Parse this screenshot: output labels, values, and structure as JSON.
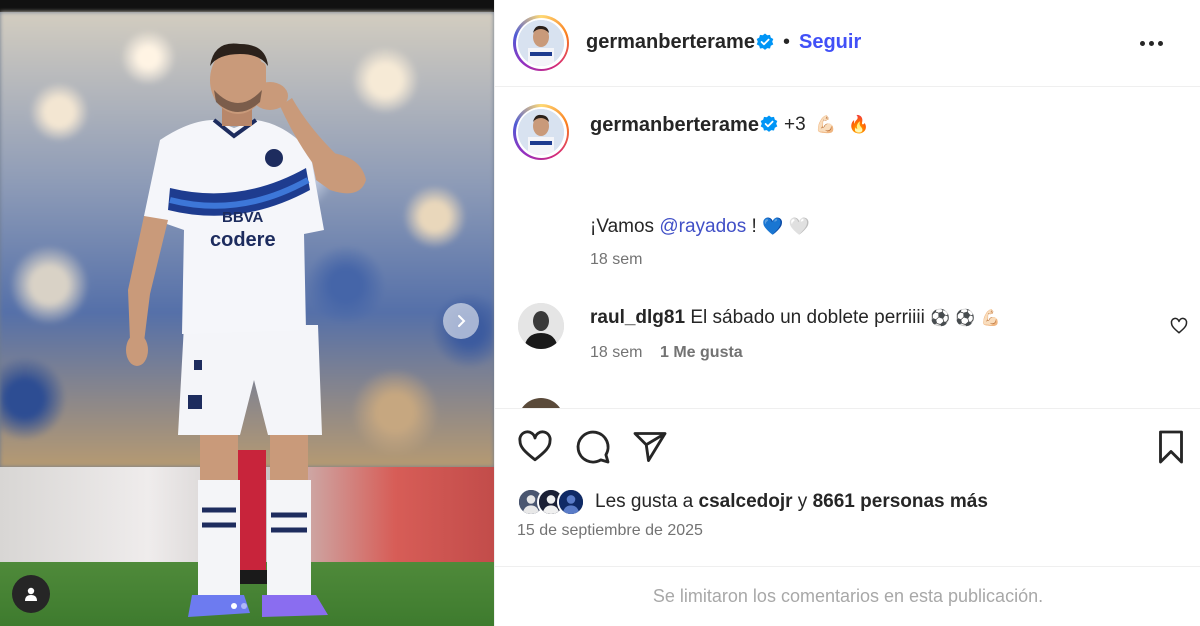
{
  "post": {
    "author": "germanberterame",
    "follow_label": "Seguir",
    "separator": "•",
    "caption_suffix": "+3",
    "caption_emojis": [
      "💪🏻",
      "🔥"
    ],
    "caption_text": "¡Vamos ",
    "caption_mention": "@rayados",
    "caption_after": " !",
    "caption_end_emojis": [
      "💙",
      "🤍"
    ],
    "caption_time": "18 sem"
  },
  "comments": [
    {
      "user": "raul_dlg81",
      "text": "El sábado un doblete perriiii",
      "emojis": [
        "⚽",
        "⚽",
        "💪🏻"
      ],
      "time": "18 sem",
      "likes_label": "1 Me gusta"
    }
  ],
  "likes": {
    "prefix": "Les gusta a ",
    "user": "csalcedojr",
    "connector": " y ",
    "count_text": "8661 personas más"
  },
  "date": "15 de septiembre de 2025",
  "limited_comments_notice": "Se limitaron los comentarios en esta publicación.",
  "icons": {
    "verified": "verified-badge-icon",
    "more": "more-options-icon",
    "like": "heart-icon",
    "comment": "comment-icon",
    "share": "share-icon",
    "save": "bookmark-icon",
    "next": "chevron-right-icon",
    "tag": "user-tag-icon"
  },
  "colors": {
    "follow": "#4150f7",
    "verified": "#0095f6",
    "mention": "#4150c7",
    "meta": "#737373"
  }
}
